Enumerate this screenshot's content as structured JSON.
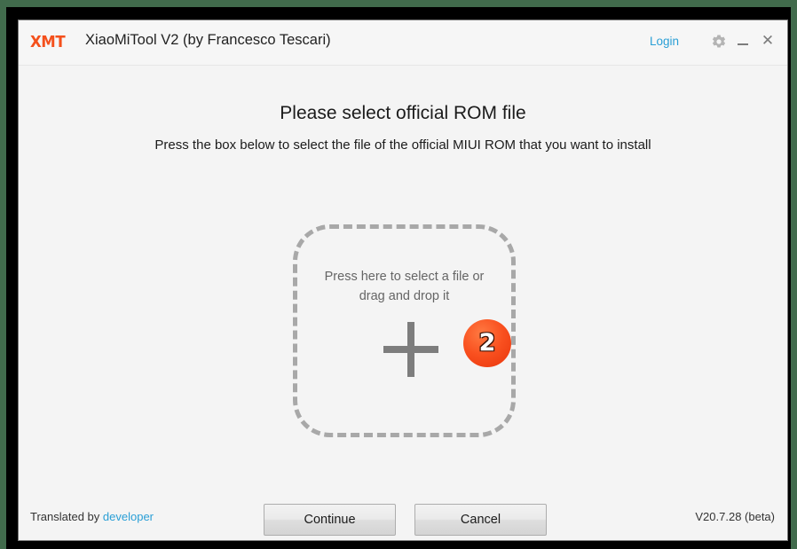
{
  "window": {
    "brand_logo": "XMT",
    "title": "XiaoMiTool V2 (by Francesco Tescari)",
    "login_label": "Login",
    "gear_icon": "gear-icon",
    "minimize_icon": "minimize-icon",
    "close_icon": "close-icon"
  },
  "main": {
    "heading": "Please select official ROM file",
    "subheading": "Press the box below to select the file of the official MIUI ROM that you want to install",
    "dropzone": {
      "text_line1": "Press here to select a file or",
      "text_line2": "drag and drop it",
      "plus_icon": "plus-icon"
    },
    "annotation": {
      "step_number": "2"
    },
    "buttons": {
      "continue": "Continue",
      "cancel": "Cancel"
    }
  },
  "footer": {
    "translated_prefix": "Translated by",
    "translator_link": "developer",
    "version": "V20.7.28 (beta)"
  },
  "colors": {
    "brand_orange": "#f4501c",
    "link_blue": "#2a9fd6",
    "badge_orange": "#f9501f",
    "dropzone_gray": "#a8a8a8",
    "window_bg": "#f4f4f4",
    "desktop_green": "#416b4c"
  }
}
